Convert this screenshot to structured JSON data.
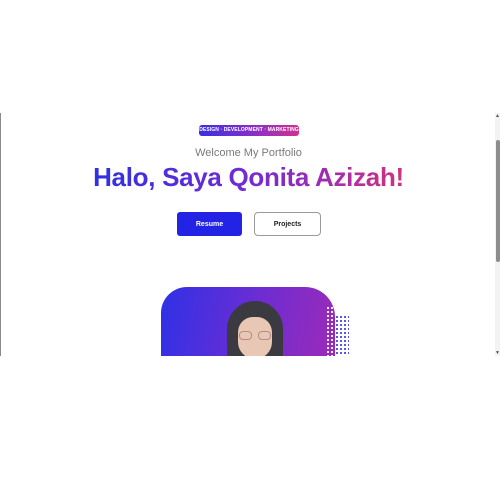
{
  "hero": {
    "badge": "DESIGN · DEVELOPMENT · MARKETING",
    "welcome": "Welcome My Portfolio",
    "headline": "Halo, Saya Qonita Azizah!",
    "buttons": {
      "primary_label": "Resume",
      "secondary_label": "Projects"
    }
  },
  "colors": {
    "accent_blue": "#2323e6",
    "accent_purple": "#7a2bd0",
    "accent_pink": "#d0327f"
  },
  "icons": {
    "scroll_up": "scroll-up-arrow-icon",
    "scroll_down": "scroll-down-arrow-icon"
  }
}
